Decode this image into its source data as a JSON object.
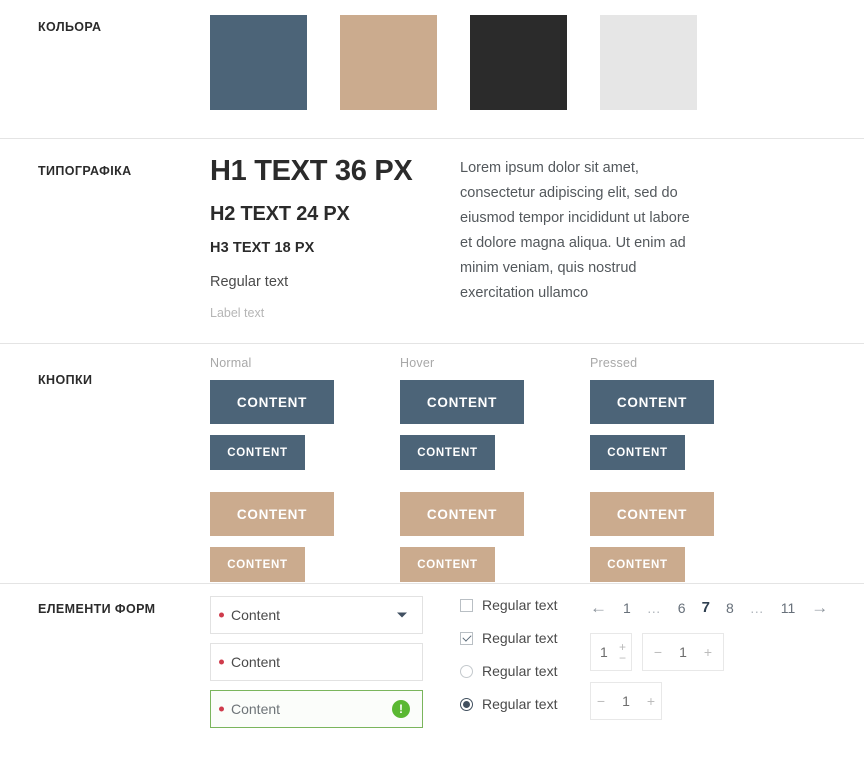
{
  "sections": {
    "colors": {
      "label": "КОЛЬОРА",
      "swatches": [
        {
          "name": "slate-blue",
          "hex": "#4c6478"
        },
        {
          "name": "tan",
          "hex": "#cbab8e"
        },
        {
          "name": "charcoal",
          "hex": "#2b2b2b"
        },
        {
          "name": "light-gray",
          "hex": "#e6e6e6"
        }
      ]
    },
    "typography": {
      "label": "ТИПОГРАФІКА",
      "h1": "H1 TEXT 36 PX",
      "h2": "H2 TEXT 24 PX",
      "h3": "H3 TEXT 18 PX",
      "regular": "Regular text",
      "small_label": "Label text",
      "paragraph": "Lorem ipsum dolor sit amet, consectetur adipiscing elit, sed do eiusmod tempor incididunt ut labore et dolore magna aliqua. Ut enim ad minim veniam, quis nostrud exercitation ullamco"
    },
    "buttons": {
      "label": "КНОПКИ",
      "states": [
        "Normal",
        "Hover",
        "Pressed"
      ],
      "button_label": "CONTENT",
      "primary_color": "#4c6478",
      "secondary_color": "#cbab8e"
    },
    "forms": {
      "label": "ЕЛЕМЕНТИ ФОРМ",
      "fields": [
        {
          "value": "Content",
          "type": "dropdown",
          "state": "default"
        },
        {
          "value": "Content",
          "type": "text",
          "state": "default"
        },
        {
          "value": "Content",
          "type": "text",
          "state": "valid"
        }
      ],
      "valid_badge": "!",
      "checkboxes": [
        {
          "label": "Regular text",
          "type": "checkbox",
          "checked": false
        },
        {
          "label": "Regular text",
          "type": "checkbox",
          "checked": true
        },
        {
          "label": "Regular text",
          "type": "radio",
          "checked": false
        },
        {
          "label": "Regular text",
          "type": "radio",
          "checked": true
        }
      ],
      "pagination": {
        "prev": "←",
        "next": "→",
        "pages": [
          "1",
          "…",
          "6",
          "7",
          "8",
          "…",
          "11"
        ],
        "active": "7"
      },
      "steppers": [
        {
          "value": "1",
          "plus": "+",
          "minus": "−",
          "orientation": "vertical"
        },
        {
          "value": "1",
          "plus": "+",
          "minus": "−",
          "orientation": "horizontal"
        },
        {
          "value": "1",
          "plus": "+",
          "minus": "−",
          "orientation": "horizontal"
        }
      ]
    }
  }
}
